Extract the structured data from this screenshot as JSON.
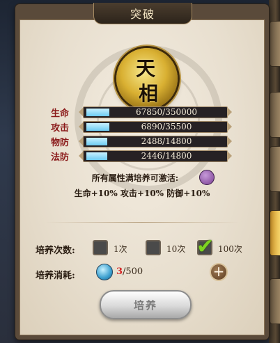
{
  "title": "突破",
  "emblem": {
    "chars": [
      "天",
      "相"
    ]
  },
  "stats": [
    {
      "label": "生命",
      "current": 67850,
      "max": 350000,
      "text": "67850/350000"
    },
    {
      "label": "攻击",
      "current": 6890,
      "max": 35500,
      "text": "6890/35500"
    },
    {
      "label": "物防",
      "current": 2488,
      "max": 14800,
      "text": "2488/14800"
    },
    {
      "label": "法防",
      "current": 2446,
      "max": 14800,
      "text": "2446/14800"
    }
  ],
  "notice": {
    "line1": "所有属性满培养可激活:",
    "line2": "生命+10% 攻击+10% 防御+10%"
  },
  "train": {
    "count_label": "培养次数:",
    "options": [
      {
        "label": "1次",
        "checked": false
      },
      {
        "label": "10次",
        "checked": false
      },
      {
        "label": "100次",
        "checked": true
      }
    ],
    "cost_label": "培养消耗:",
    "cost_have": "3",
    "cost_need": "/500",
    "button_label": "培养"
  },
  "colors": {
    "bar_fill": "#6dcbf2",
    "stat_label": "#8a1a1a",
    "cost_have": "#d32222",
    "check": "#7ed321"
  },
  "icons": {
    "search": "magnifier-icon",
    "plus": "plus-icon",
    "cost": "pill-icon"
  }
}
